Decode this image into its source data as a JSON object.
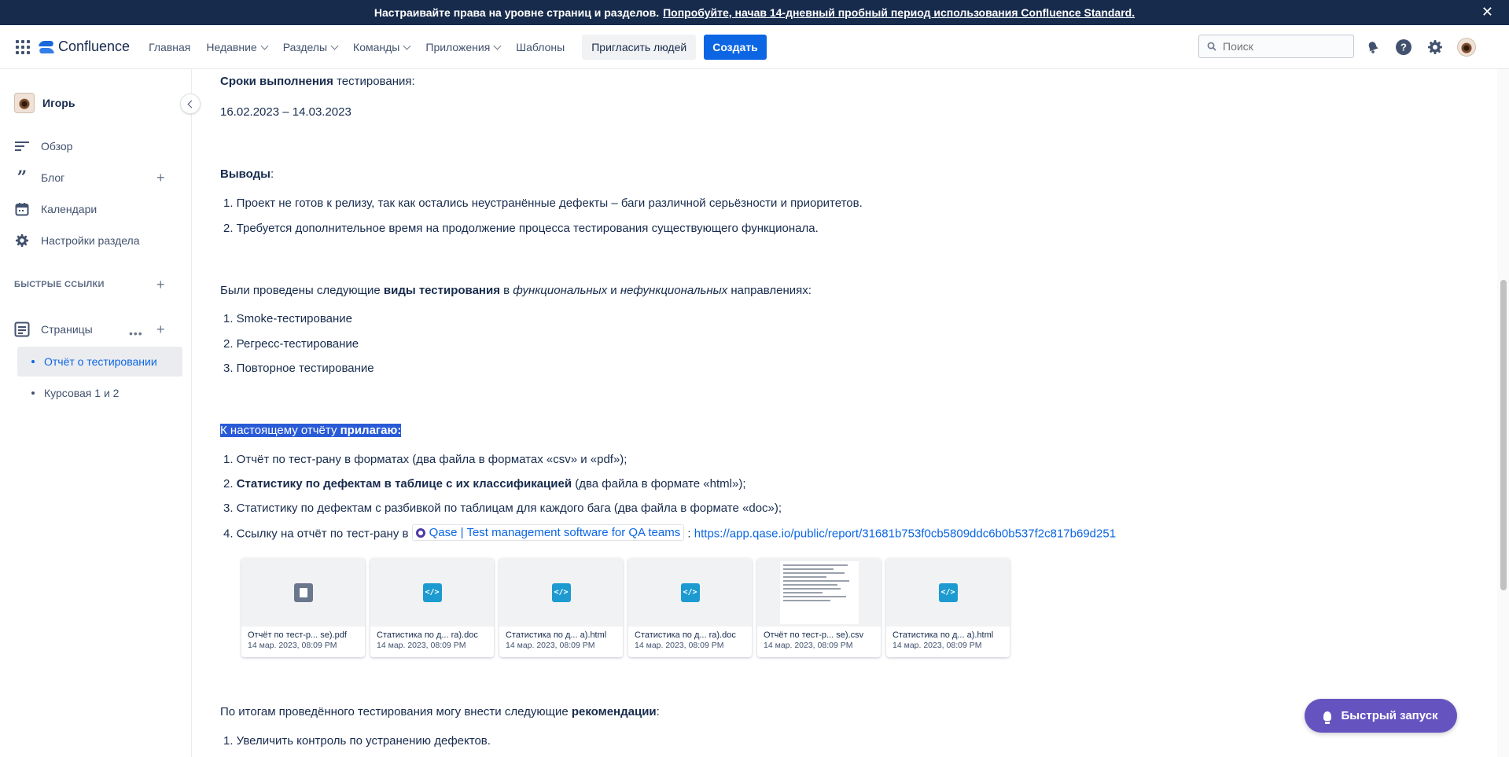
{
  "banner": {
    "text": "Настраивайте права на уровне страниц и разделов.",
    "link": "Попробуйте, начав 14-дневный пробный период использования Confluence Standard.",
    "close": "✕"
  },
  "nav": {
    "app_name": "Confluence",
    "items": [
      "Главная",
      "Недавние",
      "Разделы",
      "Команды",
      "Приложения",
      "Шаблоны"
    ],
    "invite": "Пригласить людей",
    "create": "Создать",
    "search_placeholder": "Поиск"
  },
  "sidebar": {
    "space_name": "Игорь",
    "items": [
      "Обзор",
      "Блог",
      "Календари",
      "Настройки раздела"
    ],
    "section_title": "БЫСТРЫЕ ССЫЛКИ",
    "pages_label": "Страницы",
    "pages": [
      "Отчёт о тестировании",
      "Курсовая 1 и 2"
    ]
  },
  "content": {
    "deadline": {
      "bold": "Сроки выполнения",
      "rest": " тестирования:"
    },
    "dates": "16.02.2023 – 14.03.2023",
    "conclusions_title": "Выводы",
    "conclusions_colon": ":",
    "conclusions": [
      "1. Проект не готов к релизу, так как остались неустранённые дефекты – баги различной серьёзности и приоритетов.",
      "2. Требуется дополнительное время на продолжение процесса тестирования существующего функционала."
    ],
    "types_intro": {
      "a": "Были проведены следующие ",
      "b": "виды тестирования",
      "c": " в ",
      "d": "функциональных",
      "e": " и ",
      "f": "нефункциональных",
      "g": " направлениях:"
    },
    "types": [
      "1. Smoke-тестирование",
      "2. Регресс-тестирование",
      "3. Повторное тестирование"
    ],
    "attach_intro": {
      "a": "К настоящему отчёту ",
      "b": "прилагаю:"
    },
    "attachments": {
      "item1": "1. Отчёт по тест-рану в форматах (два файла в форматах «csv» и «pdf»);",
      "item2_num": "2. ",
      "item2_bold": "Статистику по дефектам в таблице с их классификацией",
      "item2_rest": " (два файла в формате «html»);",
      "item3": "3. Статистику по дефектам с разбивкой по таблицам для каждого бага (два файла в формате «doc»);",
      "item4_prefix": "4. Ссылку на отчёт по тест-рану в ",
      "item4_link": "Qase | Test management software for QA teams",
      "item4_sep": " : ",
      "item4_url": "https://app.qase.io/public/report/31681b753f0cb5809ddc6b0b537f2c817b69d251"
    },
    "files": [
      {
        "name": "Отчёт по тест-р... se).pdf",
        "date": "14 мар. 2023, 08:09 PM",
        "kind": "pdf"
      },
      {
        "name": "Статистика по д... ra).doc",
        "date": "14 мар. 2023, 08:09 PM",
        "kind": "code"
      },
      {
        "name": "Статистика по д... a).html",
        "date": "14 мар. 2023, 08:09 PM",
        "kind": "code"
      },
      {
        "name": "Статистика по д... ra).doc",
        "date": "14 мар. 2023, 08:09 PM",
        "kind": "code"
      },
      {
        "name": "Отчёт по тест-р... se).csv",
        "date": "14 мар. 2023, 08:09 PM",
        "kind": "csv"
      },
      {
        "name": "Статистика по д... a).html",
        "date": "14 мар. 2023, 08:09 PM",
        "kind": "code"
      }
    ],
    "recommend_intro": {
      "a": "По итогам проведённого тестирования могу внести следующие ",
      "b": "рекомендации",
      "c": ":"
    },
    "recommendations": [
      "1. Увеличить контроль по устранению дефектов."
    ]
  },
  "quick_launch": "Быстрый запуск",
  "colors": {
    "accent": "#0c66e4",
    "banner": "#172b4d",
    "quick": "#6554c0",
    "highlight": "#2a5bd7"
  }
}
